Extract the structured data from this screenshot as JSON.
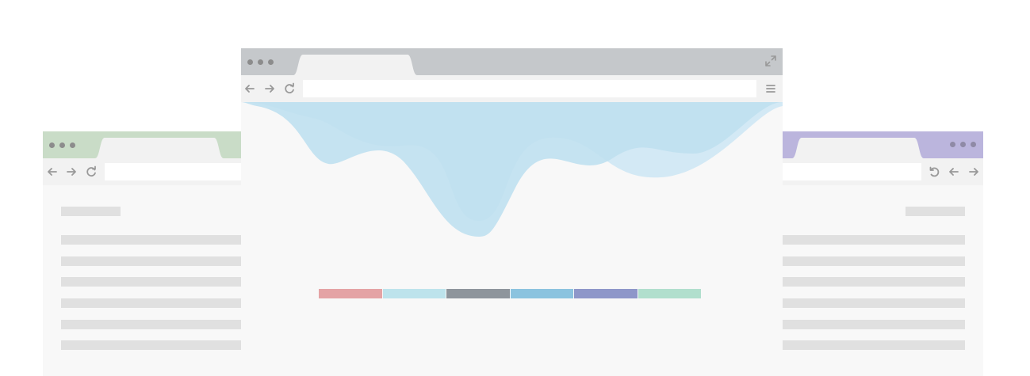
{
  "colors": {
    "titlebar_left": "#c9dcc7",
    "titlebar_center": "#c5c8cb",
    "titlebar_right": "#bbb5dd",
    "tab": "#f2f2f2",
    "toolbar": "#f2f2f2",
    "content_bg": "#f8f8f8",
    "skeleton_line": "#e0e0e0",
    "icon": "#999999",
    "dots_left": "#8c8c8c",
    "dots_right": "#8f8aa6",
    "dots_center": "#8c8c8c",
    "wave_primary": "#bfe0f0",
    "wave_secondary": "#d3e9f5"
  },
  "icons": {
    "back": "back-arrow-icon",
    "forward": "forward-arrow-icon",
    "reload": "reload-icon",
    "expand": "expand-icon",
    "menu": "hamburger-menu-icon",
    "undo": "undo-icon"
  },
  "palette": [
    "#e4a3a5",
    "#bde3ec",
    "#8e959c",
    "#8bc3df",
    "#8e97c9",
    "#b1dfcd"
  ]
}
